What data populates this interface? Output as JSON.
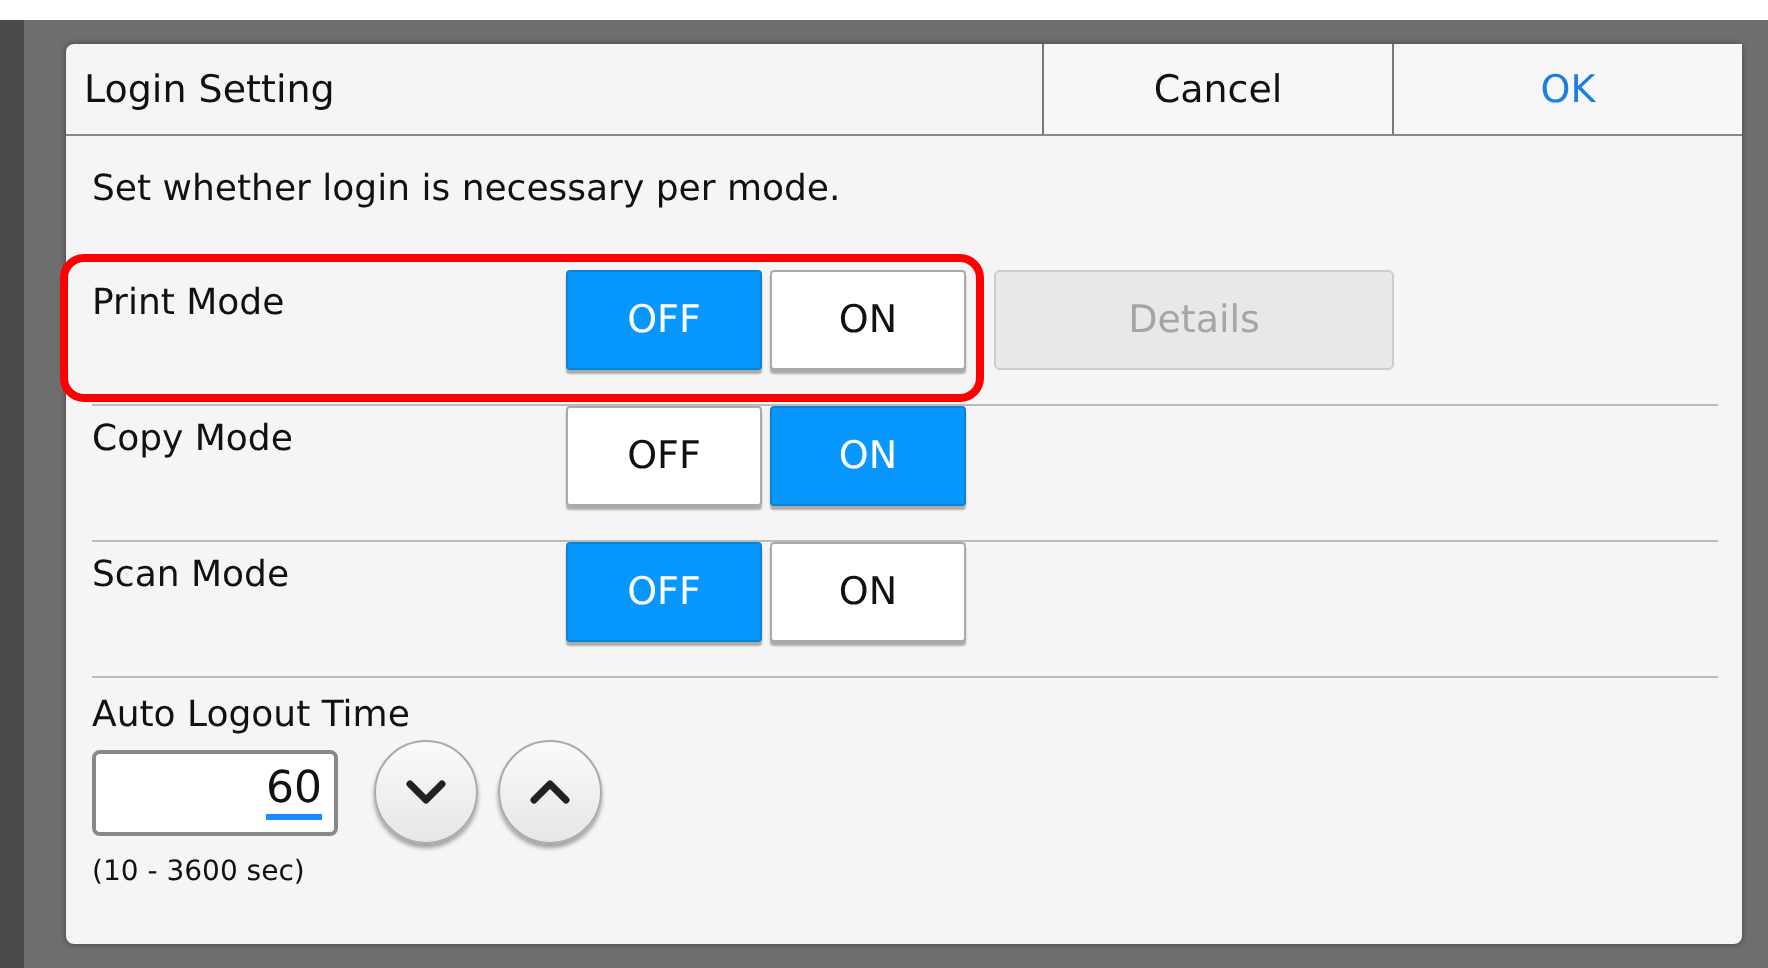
{
  "dialog": {
    "title": "Login Setting",
    "buttons": [
      {
        "label": "Cancel",
        "kind": "cancel"
      },
      {
        "label": "OK",
        "kind": "ok"
      }
    ],
    "description": "Set whether login is necessary per mode.",
    "modes": [
      {
        "name": "Print Mode",
        "options": [
          {
            "label": "OFF",
            "selected": true
          },
          {
            "label": "ON",
            "selected": false
          }
        ],
        "details": {
          "label": "Details",
          "disabled": true
        },
        "highlighted": true
      },
      {
        "name": "Copy Mode",
        "options": [
          {
            "label": "OFF",
            "selected": false
          },
          {
            "label": "ON",
            "selected": true
          }
        ],
        "highlighted": false
      },
      {
        "name": "Scan Mode",
        "options": [
          {
            "label": "OFF",
            "selected": true
          },
          {
            "label": "ON",
            "selected": false
          }
        ],
        "highlighted": false
      }
    ],
    "auto_logout": {
      "label": "Auto Logout Time",
      "value": "60",
      "range": "(10 - 3600 sec)"
    }
  }
}
